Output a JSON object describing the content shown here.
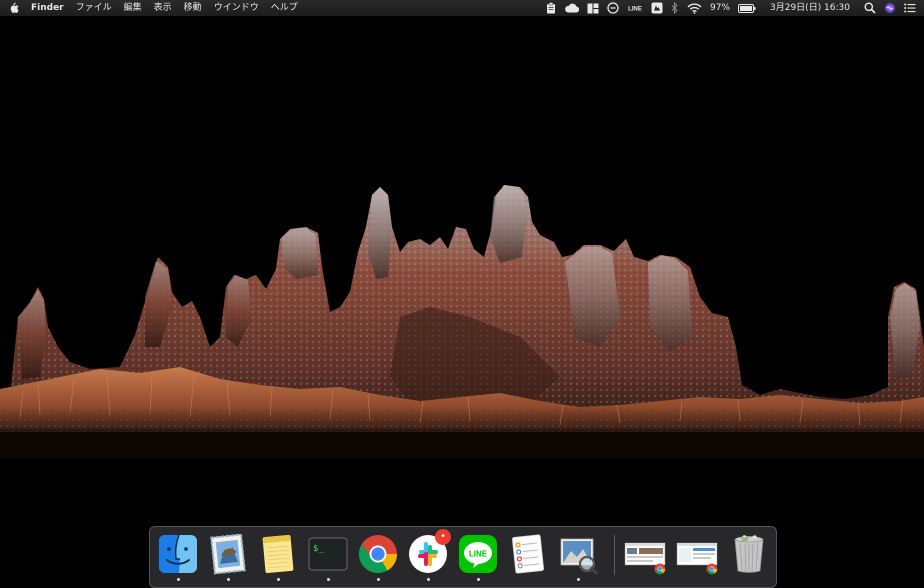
{
  "menubar": {
    "app_name": "Finder",
    "menus": [
      "ファイル",
      "編集",
      "表示",
      "移動",
      "ウインドウ",
      "ヘルプ"
    ],
    "status": {
      "line_label": "LINE",
      "battery_percent": "97%",
      "datetime": "3月29日(日)  16:30"
    }
  },
  "dock": {
    "apps": [
      {
        "name": "Finder",
        "icon": "finder-icon"
      },
      {
        "name": "Mail",
        "icon": "mail-icon"
      },
      {
        "name": "Notes",
        "icon": "notes-icon"
      },
      {
        "name": "Terminal",
        "icon": "terminal-icon",
        "text": "$_"
      },
      {
        "name": "Google Chrome",
        "icon": "chrome-icon"
      },
      {
        "name": "Slack",
        "icon": "slack-icon",
        "badge": "•"
      },
      {
        "name": "LINE",
        "icon": "line-icon",
        "text": "LINE"
      },
      {
        "name": "Reminders",
        "icon": "reminders-icon"
      },
      {
        "name": "Preview",
        "icon": "preview-icon"
      }
    ],
    "minimized": [
      {
        "name": "Chrome window 1",
        "icon": "chrome-window-thumbnail-icon"
      },
      {
        "name": "Chrome window 2",
        "icon": "chrome-window-thumbnail-icon"
      }
    ],
    "trash": {
      "name": "Trash",
      "icon": "trash-icon"
    }
  },
  "colors": {
    "menubar_bg": "#1f1f1f",
    "desktop_bg": "#000000",
    "rock_rust": "#8a4b39",
    "rock_grey": "#9a8f8c",
    "grass": "#b86a42"
  }
}
